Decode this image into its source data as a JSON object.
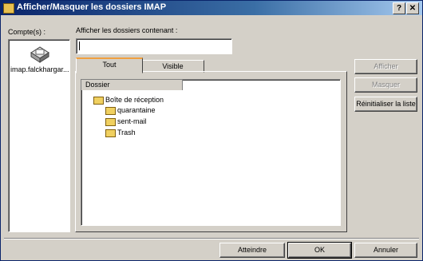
{
  "window": {
    "title": "Afficher/Masquer les dossiers IMAP",
    "help_btn": "?",
    "close_btn": "✕"
  },
  "accounts": {
    "label": "Compte(s) :",
    "items": [
      {
        "name": "imap.falckhargar..."
      }
    ]
  },
  "filter": {
    "label": "Afficher les dossiers contenant :",
    "value": ""
  },
  "tabs": [
    {
      "label": "Tout",
      "active": true
    },
    {
      "label": "Visible",
      "active": false
    }
  ],
  "tree": {
    "column_header": "Dossier",
    "items": [
      {
        "label": "Boîte de réception",
        "level": 0
      },
      {
        "label": "quarantaine",
        "level": 1
      },
      {
        "label": "sent-mail",
        "level": 1
      },
      {
        "label": "Trash",
        "level": 1
      }
    ]
  },
  "side_buttons": {
    "show": "Afficher",
    "hide": "Masquer",
    "reset": "Réinitialiser la liste"
  },
  "footer": {
    "goto": "Atteindre",
    "ok": "OK",
    "cancel": "Annuler"
  }
}
